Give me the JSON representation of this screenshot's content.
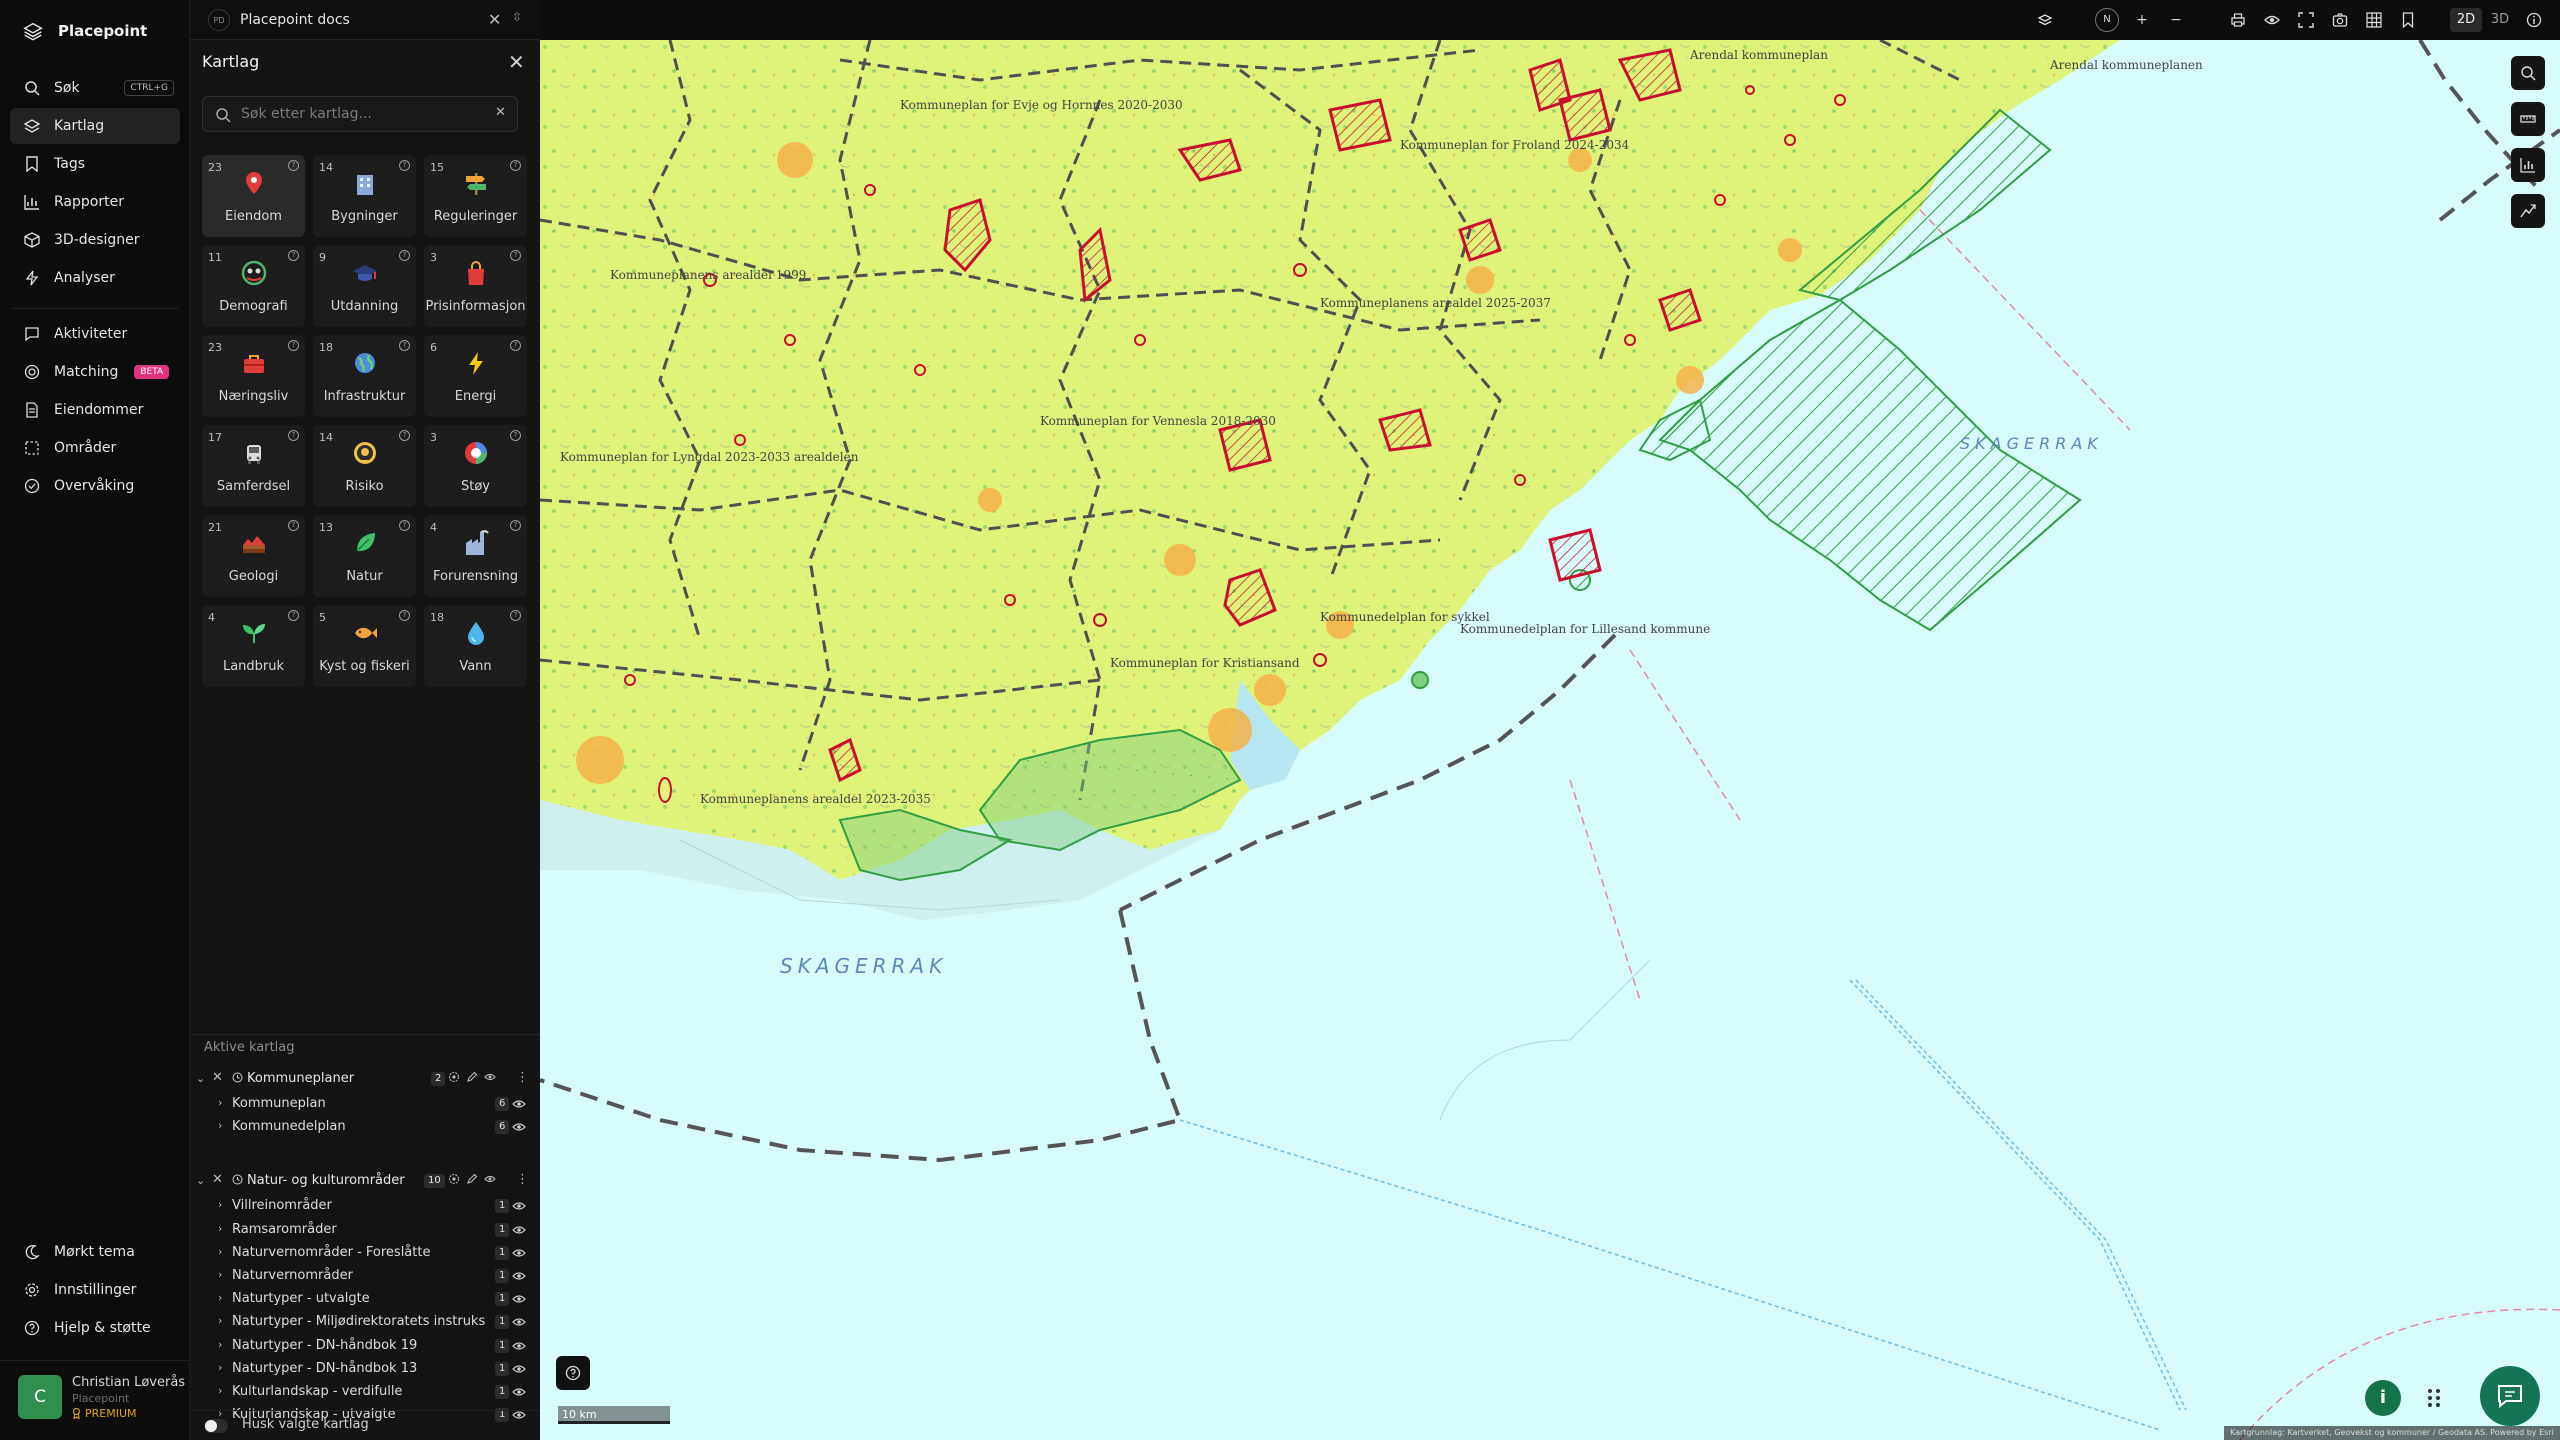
{
  "app": {
    "name": "Placepoint"
  },
  "nav": {
    "items": [
      {
        "label": "Søk",
        "shortcut": "CTRL+G",
        "icon": "search-icon"
      },
      {
        "label": "Kartlag",
        "icon": "layers-icon",
        "active": true
      },
      {
        "label": "Tags",
        "icon": "bookmark-icon"
      },
      {
        "label": "Rapporter",
        "icon": "chart-icon"
      },
      {
        "label": "3D-designer",
        "icon": "cube-icon"
      },
      {
        "label": "Analyser",
        "icon": "bolt-icon"
      },
      {
        "label": "Aktiviteter",
        "icon": "chat-icon"
      },
      {
        "label": "Matching",
        "badge": "BETA",
        "icon": "target-icon"
      },
      {
        "label": "Eiendommer",
        "icon": "document-icon"
      },
      {
        "label": "Områder",
        "icon": "area-icon"
      },
      {
        "label": "Overvåking",
        "icon": "check-circle-icon"
      }
    ],
    "bottom": [
      {
        "label": "Mørkt tema",
        "icon": "moon-icon"
      },
      {
        "label": "Innstillinger",
        "icon": "gear-icon"
      },
      {
        "label": "Hjelp & støtte",
        "icon": "help-icon"
      }
    ],
    "user": {
      "initial": "C",
      "name": "Christian Løverås",
      "org": "Placepoint",
      "tier": "PREMIUM"
    }
  },
  "tab": {
    "badge": "PD",
    "title": "Placepoint docs"
  },
  "panel": {
    "title": "Kartlag",
    "search_placeholder": "Søk etter kartlag...",
    "categories": [
      {
        "count": "23",
        "label": "Eiendom",
        "icon": "pin-icon"
      },
      {
        "count": "14",
        "label": "Bygninger",
        "icon": "building-icon"
      },
      {
        "count": "15",
        "label": "Reguleringer",
        "icon": "signpost-icon"
      },
      {
        "count": "11",
        "label": "Demografi",
        "icon": "people-icon"
      },
      {
        "count": "9",
        "label": "Utdanning",
        "icon": "graduation-cap-icon"
      },
      {
        "count": "3",
        "label": "Prisinformasjon",
        "icon": "shopping-bag-icon"
      },
      {
        "count": "23",
        "label": "Næringsliv",
        "icon": "briefcase-icon"
      },
      {
        "count": "18",
        "label": "Infrastruktur",
        "icon": "globe-icon"
      },
      {
        "count": "6",
        "label": "Energi",
        "icon": "lightning-icon"
      },
      {
        "count": "17",
        "label": "Samferdsel",
        "icon": "bus-icon"
      },
      {
        "count": "14",
        "label": "Risiko",
        "icon": "hazard-icon"
      },
      {
        "count": "3",
        "label": "Støy",
        "icon": "noise-icon"
      },
      {
        "count": "21",
        "label": "Geologi",
        "icon": "terrain-icon"
      },
      {
        "count": "13",
        "label": "Natur",
        "icon": "leaf-icon"
      },
      {
        "count": "4",
        "label": "Forurensning",
        "icon": "factory-icon"
      },
      {
        "count": "4",
        "label": "Landbruk",
        "icon": "sprout-icon"
      },
      {
        "count": "5",
        "label": "Kyst og fiskeri",
        "icon": "fish-icon"
      },
      {
        "count": "18",
        "label": "Vann",
        "icon": "water-drop-icon"
      }
    ],
    "active_title": "Aktive kartlag",
    "groups": [
      {
        "name": "Kommuneplaner",
        "count": "2",
        "layers": [
          {
            "name": "Kommuneplan",
            "count": "6"
          },
          {
            "name": "Kommunedelplan",
            "count": "6"
          }
        ]
      },
      {
        "name": "Natur- og kulturområder",
        "count": "10",
        "layers": [
          {
            "name": "Villreinområder",
            "count": "1"
          },
          {
            "name": "Ramsarområder",
            "count": "1"
          },
          {
            "name": "Naturvernområder - Foreslåtte",
            "count": "1"
          },
          {
            "name": "Naturvernområder",
            "count": "1"
          },
          {
            "name": "Naturtyper - utvalgte",
            "count": "1"
          },
          {
            "name": "Naturtyper - Miljødirektoratets instruks",
            "count": "1"
          },
          {
            "name": "Naturtyper - DN-håndbok 19",
            "count": "1"
          },
          {
            "name": "Naturtyper - DN-håndbok 13",
            "count": "1"
          },
          {
            "name": "Kulturlandskap - verdifulle",
            "count": "1"
          },
          {
            "name": "Kulturlandskap - utvalgte",
            "count": "1"
          }
        ]
      }
    ],
    "remember_label": "Husk valgte kartlag"
  },
  "toolbar": {
    "compass": "N",
    "mode_2d": "2D",
    "mode_3d": "3D"
  },
  "map": {
    "scale": "10 km",
    "attribution": "Kartgrunnlag: Kartverket, Geovekst og kommuner / Geodata AS. Powered by Esri",
    "sea_labels": [
      "SKAGERRAK",
      "SKAGERRAK"
    ],
    "labels": [
      "Kommuneplan for Evje og Hornnes 2020-2030",
      "Kommuneplan for Froland 2024-2034",
      "Kommuneplanens arealdel 1999",
      "Kommuneplanens arealdel 2025-2037",
      "Kommuneplan for Vennesla 2018-2030",
      "Kommuneplan for Lyngdal 2023-2033 arealdelen",
      "Kommuneplan for Kristiansand",
      "Kommuneplanens arealdel 2023-2035",
      "Kommunedelplan for Lillesand kommune",
      "Arendal kommuneplan",
      "Arendal kommuneplanen",
      "Kommunedelplan for sykkel"
    ],
    "colors": {
      "land": "#dff27a",
      "sea": "#d8fbfb",
      "plan_outline": "#c8102e",
      "protected": "#2f9e44",
      "boundary": "#555555"
    }
  }
}
